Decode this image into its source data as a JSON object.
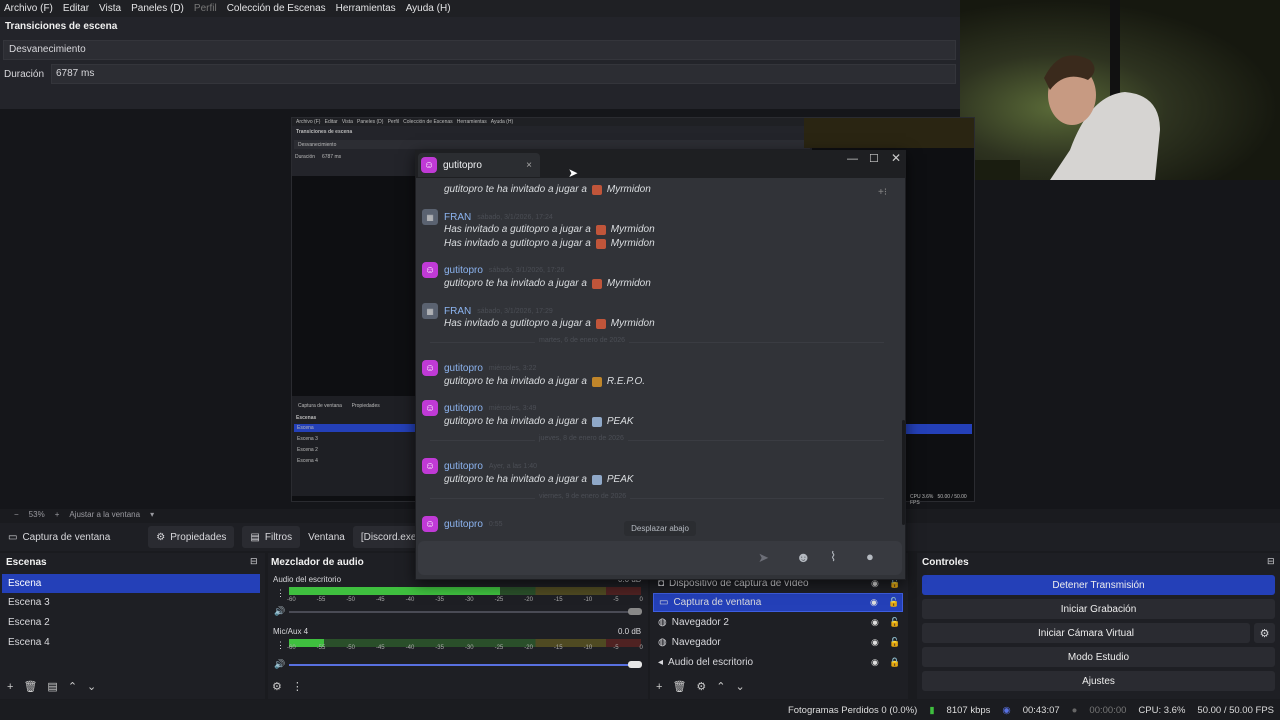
{
  "menu": {
    "items": [
      "Archivo (F)",
      "Editar",
      "Vista",
      "Paneles (D)",
      "Perfil",
      "Colección de Escenas",
      "Herramientas",
      "Ayuda (H)"
    ]
  },
  "transitions": {
    "title": "Transiciones de escena",
    "selected": "Desvanecimiento",
    "duration_label": "Duración",
    "duration_value": "6787 ms"
  },
  "zoom": {
    "level": "53%",
    "fit_label": "Ajustar a la ventana"
  },
  "source_toolbar": {
    "source_name": "Captura de ventana",
    "properties": "Propiedades",
    "filters": "Filtros",
    "window_label": "Ventana",
    "window_value": "[Discord.exe]: @guti"
  },
  "scenes": {
    "title": "Escenas",
    "items": [
      "Escena",
      "Escena 3",
      "Escena 2",
      "Escena 4"
    ]
  },
  "mixer": {
    "title": "Mezclador de audio",
    "channels": [
      {
        "name": "Audio del escritorio",
        "db": "0.0 dB",
        "level": 0.6
      },
      {
        "name": "Mic/Aux 4",
        "db": "0.0 dB",
        "level": 0.1
      }
    ],
    "ticks": [
      "-60",
      "-55",
      "-50",
      "-45",
      "-40",
      "-35",
      "-30",
      "-25",
      "-20",
      "-15",
      "-10",
      "-5",
      "0"
    ]
  },
  "sources": {
    "items": [
      "Dispositivo de captura de vídeo",
      "Captura de ventana",
      "Navegador 2",
      "Navegador",
      "Audio del escritorio"
    ]
  },
  "controls": {
    "title": "Controles",
    "stop_stream": "Detener Transmisión",
    "start_record": "Iniciar Grabación",
    "virtual_cam": "Iniciar Cámara Virtual",
    "studio_mode": "Modo Estudio",
    "settings": "Ajustes"
  },
  "status": {
    "dropped": "Fotogramas Perdidos 0 (0.0%)",
    "bitrate": "8107 kbps",
    "stream_time": "00:43:07",
    "rec_time": "00:00:00",
    "cpu": "CPU: 3.6%",
    "fps": "50.00 / 50.00 FPS"
  },
  "discord": {
    "tab_title": "gutitopro",
    "scroll_down": "Desplazar abajo",
    "messages": [
      {
        "author": "",
        "time": "",
        "lines": [
          "gutitopro te ha invitado a jugar a",
          "Myrmidon"
        ]
      },
      {
        "author": "FRAN",
        "time": "sábado, 3/1/2026, 17:24",
        "lines": [
          "Has invitado a gutitopro a jugar a",
          "Myrmidon",
          "Has invitado a gutitopro a jugar a",
          "Myrmidon"
        ]
      },
      {
        "author": "gutitopro",
        "time": "sábado, 3/1/2026, 17:26",
        "lines": [
          "gutitopro te ha invitado a jugar a",
          "Myrmidon"
        ]
      },
      {
        "author": "FRAN",
        "time": "sábado, 3/1/2026, 17:29",
        "lines": [
          "Has invitado a gutitopro a jugar a",
          "Myrmidon"
        ]
      },
      {
        "author": "gutitopro",
        "time": "miércoles, 3:22",
        "lines": [
          "gutitopro te ha invitado a jugar a",
          "R.E.P.O."
        ]
      },
      {
        "author": "gutitopro",
        "time": "miércoles, 3:49",
        "lines": [
          "gutitopro te ha invitado a jugar a",
          "PEAK"
        ]
      },
      {
        "author": "gutitopro",
        "time": "Ayer, a las 1:40",
        "lines": [
          "gutitopro te ha invitado a jugar a",
          "PEAK"
        ]
      },
      {
        "author": "gutitopro",
        "time": "0:55",
        "lines": []
      }
    ],
    "separators": [
      "martes, 6 de enero de 2026",
      "jueves, 8 de enero de 2026",
      "viernes, 9 de enero de 2026"
    ]
  },
  "colors": {
    "accent": "#2440b8",
    "meter_green": "#3fbf3f",
    "meter_yellow": "#c9b93a",
    "meter_red": "#b83a3a",
    "discord_bg": "#313338",
    "discord_link": "#8cb4f0"
  }
}
